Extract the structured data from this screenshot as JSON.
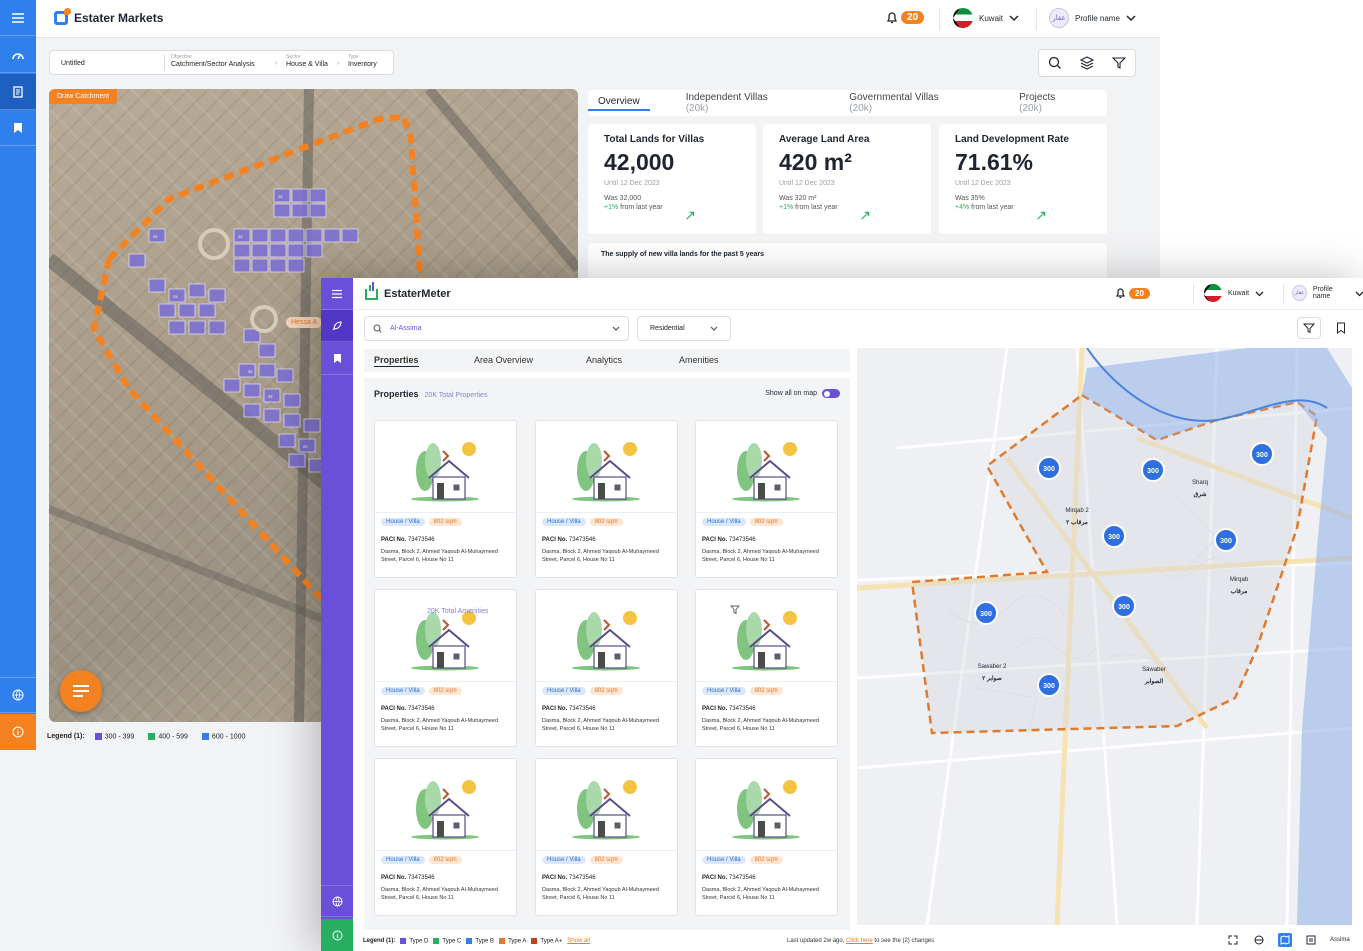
{
  "markets": {
    "app_name": "Estater Markets",
    "notifications": "20",
    "country": "Kuwait",
    "profile": "Profile name",
    "avatar_text": "عقار",
    "analysis_name": "Untitled",
    "breadcrumb": [
      {
        "label": "Objective",
        "value": "Catchment/Sector Analysis"
      },
      {
        "label": "Sector",
        "value": "House & Villa"
      },
      {
        "label": "Type",
        "value": "Inventory"
      }
    ],
    "draw_catchment": "Draw Catchment",
    "map_street_label": "Hessa A",
    "parcel_label": "25",
    "legend_title": "Legend (1):",
    "legend": [
      {
        "label": "300 - 399",
        "color": "#6a4fd8"
      },
      {
        "label": "400 - 599",
        "color": "#27ae60"
      },
      {
        "label": "600 - 1000",
        "color": "#2f80ed"
      }
    ],
    "tabs": [
      {
        "label": "Overview",
        "count": ""
      },
      {
        "label": "Independent Villas",
        "count": "(20k)"
      },
      {
        "label": "Governmental Villas",
        "count": "(20k)"
      },
      {
        "label": "Projects",
        "count": "(20k)"
      }
    ],
    "kpis": [
      {
        "title": "Total Lands for Villas",
        "value": "42,000",
        "until": "Until 12 Dec 2023",
        "was": "Was 32,000",
        "change": "+1%",
        "change_text": "from last year"
      },
      {
        "title": "Average Land Area",
        "value": "420 m²",
        "until": "Until 12 Dec 2023",
        "was": "Was 320 m²",
        "change": "+1%",
        "change_text": "from last year"
      },
      {
        "title": "Land Development Rate",
        "value": "71.61%",
        "until": "Until 12 Dec 2023",
        "was": "Was 35%",
        "change": "+4%",
        "change_text": "from last year"
      }
    ],
    "supply_title": "The supply of new villa lands for the past 5 years",
    "accent": "#2f80ed",
    "orange": "#f58220"
  },
  "meter": {
    "app_name": "EstaterMeter",
    "notifications": "20",
    "country": "Kuwait",
    "profile": "Profile name",
    "avatar_text": "عقار",
    "search_value": "Al-Assima",
    "type_select": "Residential",
    "tabs": [
      "Properties",
      "Area Overview",
      "Analytics",
      "Amenities"
    ],
    "properties_title": "Properties",
    "properties_total": "20K Total Properties",
    "show_all_on_map": "Show all on map",
    "amenities_overlay": "20K Total Amenities",
    "cards": [
      {
        "tag_type": "House / Villa",
        "tag_area": "802 sqm",
        "paci_label": "PACI No.",
        "paci": "73473546",
        "address": "Dasma, Block 2, Ahmed Yaqoub Al-Muhaymeed Street, Parcel 6, House No 11"
      },
      {
        "tag_type": "House / Villa",
        "tag_area": "802 sqm",
        "paci_label": "PACI No.",
        "paci": "73473546",
        "address": "Dasma, Block 2, Ahmed Yaqoub Al-Muhaymeed Street, Parcel 6, House No 11"
      },
      {
        "tag_type": "House / Villa",
        "tag_area": "802 sqm",
        "paci_label": "PACI No.",
        "paci": "73473546",
        "address": "Dasma, Block 2, Ahmed Yaqoub Al-Muhaymeed Street, Parcel 6, House No 11"
      },
      {
        "tag_type": "House / Villa",
        "tag_area": "802 sqm",
        "paci_label": "PACI No.",
        "paci": "73473546",
        "address": "Dasma, Block 2, Ahmed Yaqoub Al-Muhaymeed Street, Parcel 6, House No 11"
      },
      {
        "tag_type": "House / Villa",
        "tag_area": "802 sqm",
        "paci_label": "PACI No.",
        "paci": "73473546",
        "address": "Dasma, Block 2, Ahmed Yaqoub Al-Muhaymeed Street, Parcel 6, House No 11"
      },
      {
        "tag_type": "House / Villa",
        "tag_area": "802 sqm",
        "paci_label": "PACI No.",
        "paci": "73473546",
        "address": "Dasma, Block 2, Ahmed Yaqoub Al-Muhaymeed Street, Parcel 6, House No 11"
      },
      {
        "tag_type": "House / Villa",
        "tag_area": "802 sqm",
        "paci_label": "PACI No.",
        "paci": "73473546",
        "address": "Dasma, Block 2, Ahmed Yaqoub Al-Muhaymeed Street, Parcel 6, House No 11"
      },
      {
        "tag_type": "House / Villa",
        "tag_area": "802 sqm",
        "paci_label": "PACI No.",
        "paci": "73473546",
        "address": "Dasma, Block 2, Ahmed Yaqoub Al-Muhaymeed Street, Parcel 6, House No 11"
      },
      {
        "tag_type": "House / Villa",
        "tag_area": "802 sqm",
        "paci_label": "PACI No.",
        "paci": "73473546",
        "address": "Dasma, Block 2, Ahmed Yaqoub Al-Muhaymeed Street, Parcel 6, House No 11"
      }
    ],
    "map_cluster_value": "300",
    "map_places": [
      {
        "en": "Sharq",
        "ar": "شرق"
      },
      {
        "en": "Mirqab 2",
        "ar": "مرقاب ٢"
      },
      {
        "en": "Mirqab",
        "ar": "مرقاب"
      },
      {
        "en": "Sawaber 2",
        "ar": "صوابر ٢"
      },
      {
        "en": "Sawaber",
        "ar": "الصوابر"
      }
    ],
    "legend_title": "Legend (1):",
    "legend": [
      {
        "label": "Type D",
        "color": "#6a4fd8"
      },
      {
        "label": "Type C",
        "color": "#27ae60"
      },
      {
        "label": "Type B",
        "color": "#2f80ed"
      },
      {
        "label": "Type A",
        "color": "#e07a2d"
      },
      {
        "label": "Type A+",
        "color": "#b5451b"
      }
    ],
    "show_all": "Show all",
    "updated_prefix": "Last updated 2w ago,",
    "updated_link": "Click here",
    "updated_suffix": "to see the (2) changes",
    "area_name": "Assima",
    "accent": "#6a4fd8",
    "success": "#27ae60"
  }
}
